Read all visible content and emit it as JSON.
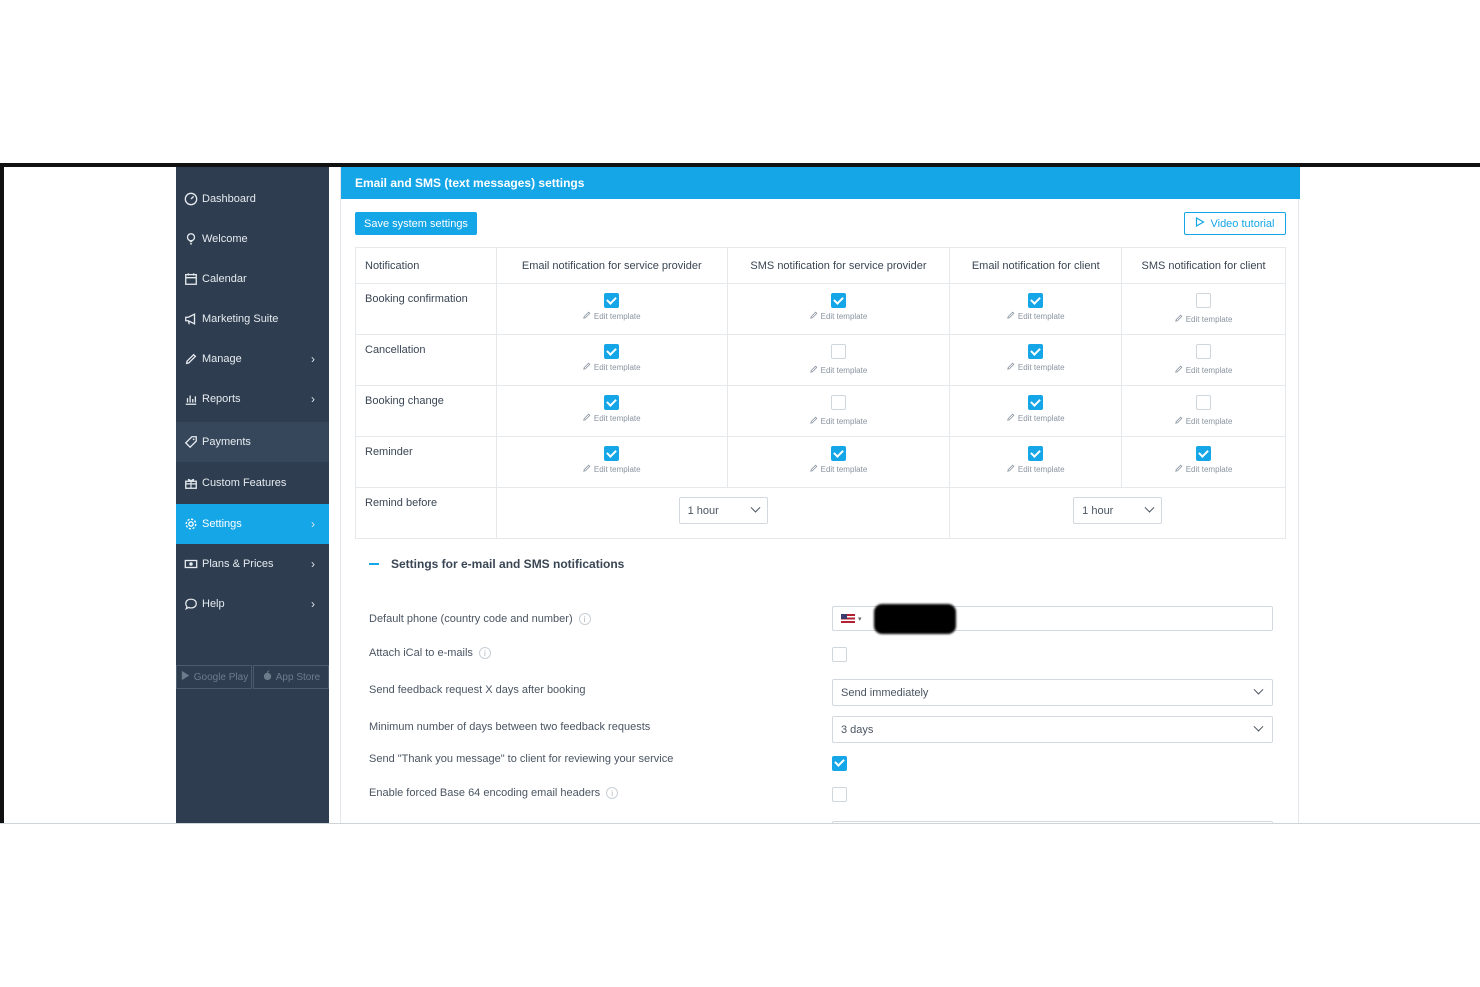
{
  "sidebar": {
    "items": [
      {
        "label": "Dashboard",
        "icon": "dashboard-icon",
        "chevron": false
      },
      {
        "label": "Welcome",
        "icon": "lightbulb-icon",
        "chevron": false
      },
      {
        "label": "Calendar",
        "icon": "calendar-icon",
        "chevron": false
      },
      {
        "label": "Marketing Suite",
        "icon": "megaphone-icon",
        "chevron": false
      },
      {
        "label": "Manage",
        "icon": "pencil-icon",
        "chevron": true
      },
      {
        "label": "Reports",
        "icon": "bar-chart-icon",
        "chevron": true
      },
      {
        "label": "Payments",
        "icon": "tag-icon",
        "chevron": false
      },
      {
        "label": "Custom Features",
        "icon": "gift-icon",
        "chevron": false
      },
      {
        "label": "Settings",
        "icon": "gear-icon",
        "chevron": true,
        "active": true
      },
      {
        "label": "Plans & Prices",
        "icon": "money-icon",
        "chevron": true
      },
      {
        "label": "Help",
        "icon": "chat-bubble-icon",
        "chevron": true
      }
    ],
    "chevron_glyph": "›",
    "store": {
      "google": "Google Play",
      "apple": "App Store"
    }
  },
  "header": {
    "title": "Email and SMS (text messages) settings"
  },
  "toolbar": {
    "save_label": "Save system settings",
    "video_label": "Video tutorial"
  },
  "table": {
    "columns": [
      "Notification",
      "Email notification for service provider",
      "SMS notification for service provider",
      "Email notification for client",
      "SMS notification for client"
    ],
    "edit_label": "Edit template",
    "rows": [
      {
        "label": "Booking confirmation",
        "checks": [
          true,
          true,
          true,
          false
        ]
      },
      {
        "label": "Cancellation",
        "checks": [
          true,
          false,
          true,
          false
        ]
      },
      {
        "label": "Booking change",
        "checks": [
          true,
          false,
          true,
          false
        ]
      },
      {
        "label": "Reminder",
        "checks": [
          true,
          true,
          true,
          true
        ]
      }
    ],
    "remind_before": {
      "label": "Remind before",
      "provider_value": "1 hour",
      "client_value": "1 hour"
    }
  },
  "section": {
    "title": "Settings for e-mail and SMS notifications",
    "default_phone_label": "Default phone (country code and number)",
    "ical_label": "Attach iCal to e-mails",
    "ical_checked": false,
    "feedback_label": "Send feedback request X days after booking",
    "feedback_value": "Send immediately",
    "min_days_label": "Minimum number of days between two feedback requests",
    "min_days_value": "3 days",
    "thank_you_label": "Send \"Thank you message\" to client for reviewing your service",
    "thank_you_checked": true,
    "base64_label": "Enable forced Base 64 encoding email headers",
    "base64_checked": false,
    "info_glyph": "i"
  },
  "colors": {
    "accent": "#15a6e8",
    "sidebar_bg": "#2e3d4f"
  }
}
